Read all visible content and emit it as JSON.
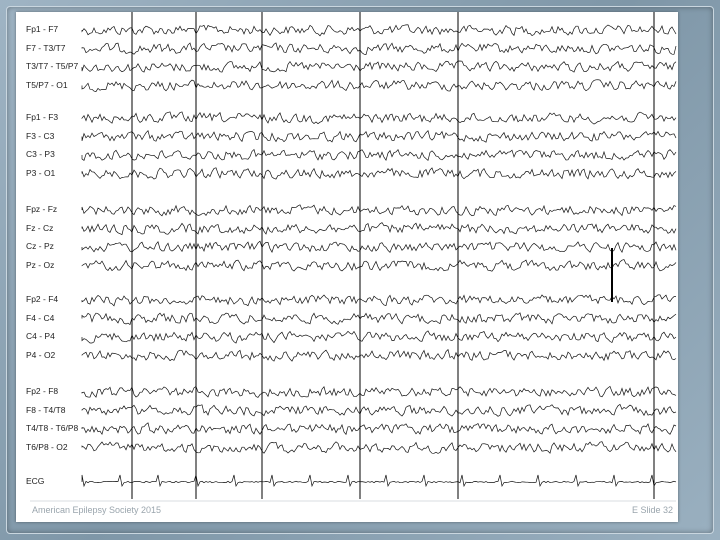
{
  "footer": {
    "left": "American Epilepsy Society 2015",
    "right": "E Slide 32"
  },
  "channel_groups": [
    [
      "Fp1 - F7",
      "F7 - T3/T7",
      "T3/T7 - T5/P7",
      "T5/P7 - O1"
    ],
    [
      "Fp1 - F3",
      "F3 - C3",
      "C3 - P3",
      "P3 - O1"
    ],
    [
      "Fpz - Fz",
      "Fz - Cz",
      "Cz - Pz",
      "Pz - Oz"
    ],
    [
      "Fp2 - F4",
      "F4 - C4",
      "C4 - P4",
      "P4 - O2"
    ],
    [
      "Fp2 - F8",
      "F8 - T4/T8",
      "T4/T8 - T6/P8",
      "T6/P8 - O2"
    ],
    [
      "ECG"
    ]
  ],
  "colors": {
    "trace": "#111111",
    "background": "#ffffff",
    "frame": "#8fa6b6"
  }
}
